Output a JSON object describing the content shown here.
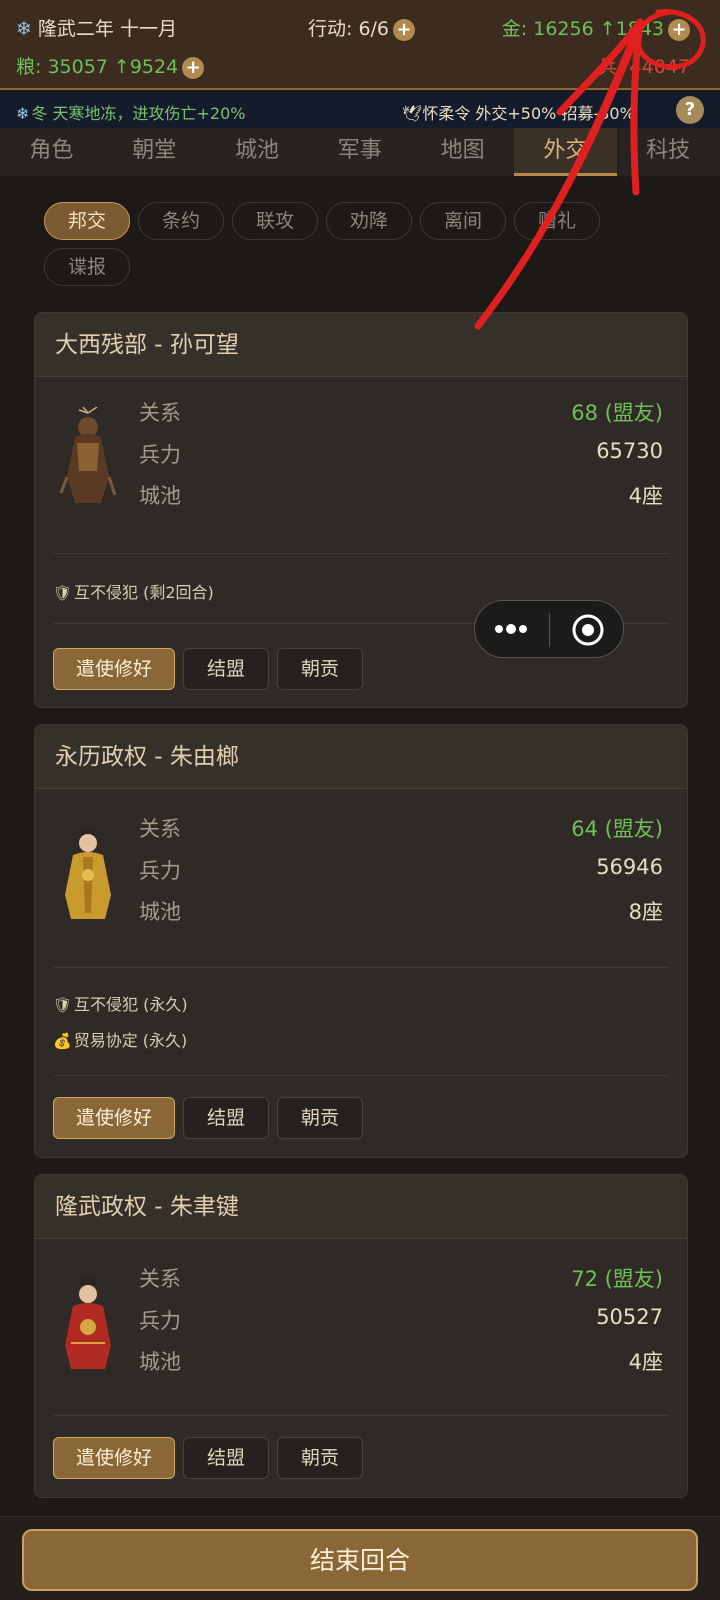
{
  "status": {
    "date": "隆武二年 十一月",
    "actions": "行动: 6/6",
    "gold": "金: 16256 ↑1843",
    "grain": "粮: 35057 ↑9524",
    "troops": "兵: 44047",
    "plus": "+"
  },
  "effects": {
    "season": "冬 天寒地冻，进攻伤亡+20%",
    "policy": "怀柔令 外交+50% 招募-30%",
    "help": "?"
  },
  "tabs": [
    "角色",
    "朝堂",
    "城池",
    "军事",
    "地图",
    "外交",
    "科技"
  ],
  "active_tab": "外交",
  "subtabs": [
    "邦交",
    "条约",
    "联攻",
    "劝降",
    "离间",
    "赠礼",
    "谍报"
  ],
  "active_subtab": "邦交",
  "stat_labels": {
    "relation": "关系",
    "troops": "兵力",
    "cities": "城池"
  },
  "factions": [
    {
      "title": "大西残部 - 孙可望",
      "relation": "68 (盟友)",
      "troops": "65730",
      "cities": "4座",
      "treaties": [
        "互不侵犯 (剩2回合)"
      ]
    },
    {
      "title": "永历政权 - 朱由榔",
      "relation": "64 (盟友)",
      "troops": "56946",
      "cities": "8座",
      "treaties": [
        "互不侵犯 (永久)",
        "贸易协定 (永久)"
      ]
    },
    {
      "title": "隆武政权 - 朱聿键",
      "relation": "72 (盟友)",
      "troops": "50527",
      "cities": "4座",
      "treaties": []
    }
  ],
  "buttons": {
    "envoy": "遣使修好",
    "ally": "结盟",
    "tribute": "朝贡"
  },
  "end_turn": "结束回合",
  "colors": {
    "accent": "#b08a4e",
    "positive": "#6fbf5a",
    "negative": "#d0493a",
    "annotation": "#e02020"
  }
}
